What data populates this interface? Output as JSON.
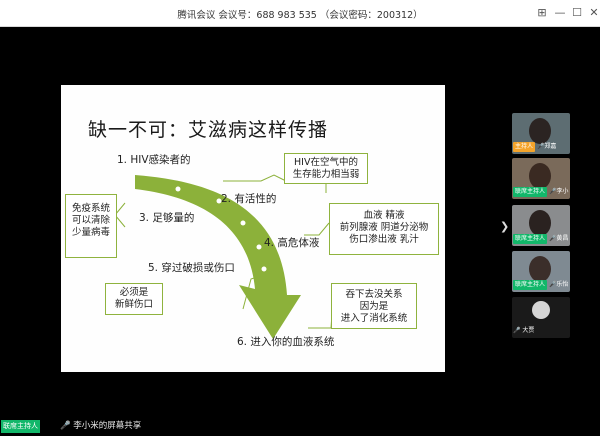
{
  "window": {
    "title": "腾讯会议  会议号：688 983 535 （会议密码：200312）"
  },
  "slide": {
    "title": "缺一不可：艾滋病这样传播",
    "steps": [
      "1. HIV感染者的",
      "2. 有活性的",
      "3. 足够量的",
      "4. 高危体液",
      "5. 穿过破损或伤口",
      "6. 进入你的血液系统"
    ],
    "boxes": {
      "hiv_air": [
        "HIV在空气中的",
        "生存能力相当弱"
      ],
      "immune": [
        "免疫系统",
        "可以清除",
        "少量病毒"
      ],
      "fluids": [
        "血液   精液",
        "前列腺液   阴道分泌物",
        "伤口渗出液   乳汁"
      ],
      "wound": [
        "必须是",
        "新鲜伤口"
      ],
      "swallow": [
        "吞下去没关系",
        "因为是",
        "进入了消化系统"
      ]
    }
  },
  "participants": [
    {
      "role": "主持人",
      "name": "郑嘉",
      "role_color": "#f4a42b"
    },
    {
      "role": "联席主持人",
      "name": "李小",
      "role_color": "#12b76a"
    },
    {
      "role": "联席主持人",
      "name": "黄昌",
      "role_color": "#12b76a"
    },
    {
      "role": "联席主持人",
      "name": "乐怡",
      "role_color": "#12b76a"
    },
    {
      "role": "",
      "name": "大贾",
      "role_color": ""
    }
  ],
  "status": {
    "host_badge": "联席主持人",
    "share_label": "李小米的屏幕共享"
  },
  "colors": {
    "accent": "#8cb13a",
    "host_green": "#12b76a",
    "host_orange": "#f4a42b"
  }
}
